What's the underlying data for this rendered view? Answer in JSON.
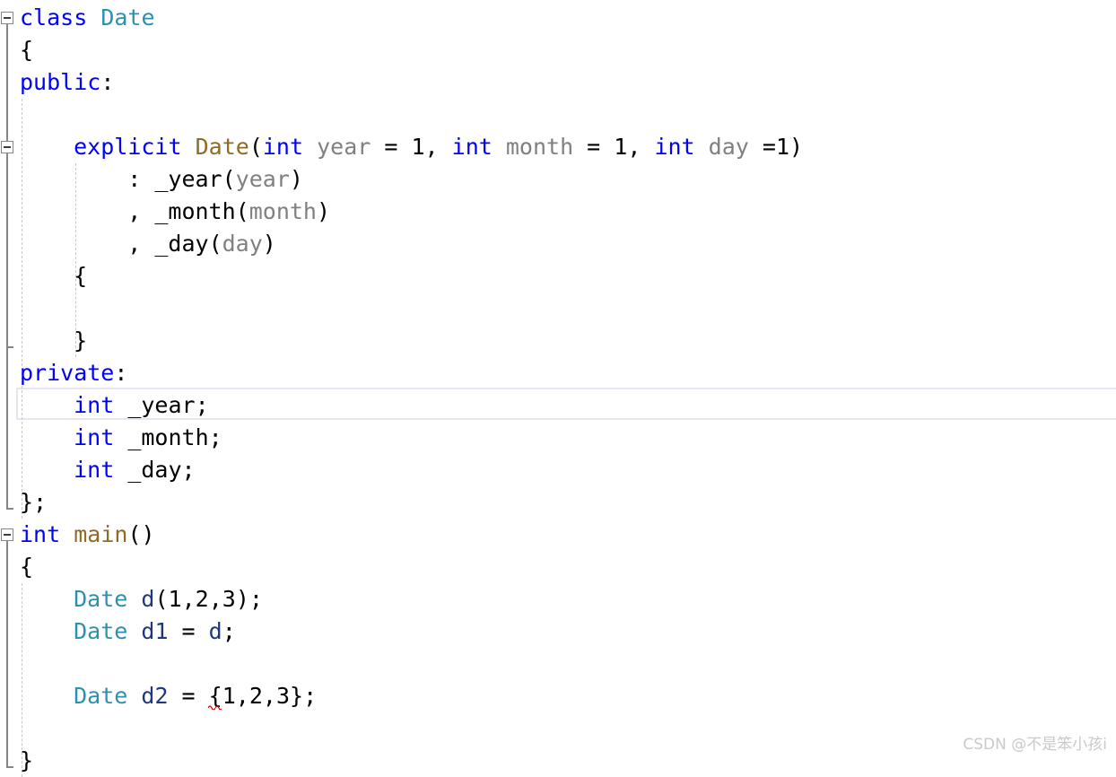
{
  "editor": {
    "language": "cpp",
    "background_color": "#ffffff",
    "current_line_number": 12,
    "colors": {
      "keyword": "#0000ff",
      "type": "#2b91af",
      "function": "#8f6a23",
      "parameter": "#808080",
      "local_variable": "#1f377f",
      "plain_text": "#000000",
      "indent_guide": "#c8c8c8",
      "fold_marker": "#868686",
      "current_line_border": "#e6e6f0",
      "error_squiggle": "#e00000",
      "watermark": "#c9c9c9"
    }
  },
  "gutter": {
    "fold_markers": [
      {
        "name": "fold-class-date",
        "state": "expanded",
        "line": 1
      },
      {
        "name": "fold-constructor",
        "state": "expanded",
        "line": 5
      },
      {
        "name": "fold-main",
        "state": "expanded",
        "line": 17
      }
    ]
  },
  "code_lines": [
    {
      "n": 1,
      "indent": 0,
      "tokens": [
        {
          "t": "class",
          "c": "kw"
        },
        {
          "t": " ",
          "c": "punct"
        },
        {
          "t": "Date",
          "c": "type"
        }
      ]
    },
    {
      "n": 2,
      "indent": 0,
      "tokens": [
        {
          "t": "{",
          "c": "punct"
        }
      ]
    },
    {
      "n": 3,
      "indent": 0,
      "tokens": [
        {
          "t": "public",
          "c": "kw"
        },
        {
          "t": ":",
          "c": "punct"
        }
      ]
    },
    {
      "n": 4,
      "indent": 0,
      "tokens": []
    },
    {
      "n": 5,
      "indent": 1,
      "tokens": [
        {
          "t": "explicit",
          "c": "kw"
        },
        {
          "t": " ",
          "c": "punct"
        },
        {
          "t": "Date",
          "c": "fn"
        },
        {
          "t": "(",
          "c": "punct"
        },
        {
          "t": "int",
          "c": "kw"
        },
        {
          "t": " ",
          "c": "punct"
        },
        {
          "t": "year",
          "c": "ident"
        },
        {
          "t": " = ",
          "c": "punct"
        },
        {
          "t": "1",
          "c": "num"
        },
        {
          "t": ", ",
          "c": "punct"
        },
        {
          "t": "int",
          "c": "kw"
        },
        {
          "t": " ",
          "c": "punct"
        },
        {
          "t": "month",
          "c": "ident"
        },
        {
          "t": " = ",
          "c": "punct"
        },
        {
          "t": "1",
          "c": "num"
        },
        {
          "t": ", ",
          "c": "punct"
        },
        {
          "t": "int",
          "c": "kw"
        },
        {
          "t": " ",
          "c": "punct"
        },
        {
          "t": "day",
          "c": "ident"
        },
        {
          "t": " =",
          "c": "punct"
        },
        {
          "t": "1",
          "c": "num"
        },
        {
          "t": ")",
          "c": "punct"
        }
      ]
    },
    {
      "n": 6,
      "indent": 2,
      "tokens": [
        {
          "t": ": ",
          "c": "punct"
        },
        {
          "t": "_year",
          "c": "punct"
        },
        {
          "t": "(",
          "c": "punct"
        },
        {
          "t": "year",
          "c": "ident"
        },
        {
          "t": ")",
          "c": "punct"
        }
      ]
    },
    {
      "n": 7,
      "indent": 2,
      "tokens": [
        {
          "t": ", ",
          "c": "punct"
        },
        {
          "t": "_month",
          "c": "punct"
        },
        {
          "t": "(",
          "c": "punct"
        },
        {
          "t": "month",
          "c": "ident"
        },
        {
          "t": ")",
          "c": "punct"
        }
      ]
    },
    {
      "n": 8,
      "indent": 2,
      "tokens": [
        {
          "t": ", ",
          "c": "punct"
        },
        {
          "t": "_day",
          "c": "punct"
        },
        {
          "t": "(",
          "c": "punct"
        },
        {
          "t": "day",
          "c": "ident"
        },
        {
          "t": ")",
          "c": "punct"
        }
      ]
    },
    {
      "n": 9,
      "indent": 1,
      "tokens": [
        {
          "t": "{",
          "c": "punct"
        }
      ]
    },
    {
      "n": 10,
      "indent": 0,
      "tokens": []
    },
    {
      "n": 11,
      "indent": 1,
      "tokens": [
        {
          "t": "}",
          "c": "punct"
        }
      ]
    },
    {
      "n": 12,
      "indent": 0,
      "tokens": [
        {
          "t": "private",
          "c": "kw"
        },
        {
          "t": ":",
          "c": "punct"
        }
      ]
    },
    {
      "n": 13,
      "indent": 1,
      "tokens": [
        {
          "t": "int",
          "c": "kw"
        },
        {
          "t": " ",
          "c": "punct"
        },
        {
          "t": "_year",
          "c": "punct"
        },
        {
          "t": ";",
          "c": "punct"
        }
      ]
    },
    {
      "n": 14,
      "indent": 1,
      "tokens": [
        {
          "t": "int",
          "c": "kw"
        },
        {
          "t": " ",
          "c": "punct"
        },
        {
          "t": "_month",
          "c": "punct"
        },
        {
          "t": ";",
          "c": "punct"
        }
      ]
    },
    {
      "n": 15,
      "indent": 1,
      "tokens": [
        {
          "t": "int",
          "c": "kw"
        },
        {
          "t": " ",
          "c": "punct"
        },
        {
          "t": "_day",
          "c": "punct"
        },
        {
          "t": ";",
          "c": "punct"
        }
      ]
    },
    {
      "n": 16,
      "indent": 0,
      "tokens": [
        {
          "t": "};",
          "c": "punct"
        }
      ]
    },
    {
      "n": 17,
      "indent": 0,
      "tokens": [
        {
          "t": "int",
          "c": "kw"
        },
        {
          "t": " ",
          "c": "punct"
        },
        {
          "t": "main",
          "c": "fn"
        },
        {
          "t": "()",
          "c": "punct"
        }
      ]
    },
    {
      "n": 18,
      "indent": 0,
      "tokens": [
        {
          "t": "{",
          "c": "punct"
        }
      ]
    },
    {
      "n": 19,
      "indent": 1,
      "tokens": [
        {
          "t": "Date",
          "c": "type"
        },
        {
          "t": " ",
          "c": "punct"
        },
        {
          "t": "d",
          "c": "var"
        },
        {
          "t": "(",
          "c": "punct"
        },
        {
          "t": "1",
          "c": "num"
        },
        {
          "t": ",",
          "c": "punct"
        },
        {
          "t": "2",
          "c": "num"
        },
        {
          "t": ",",
          "c": "punct"
        },
        {
          "t": "3",
          "c": "num"
        },
        {
          "t": ");",
          "c": "punct"
        }
      ]
    },
    {
      "n": 20,
      "indent": 1,
      "tokens": [
        {
          "t": "Date",
          "c": "type"
        },
        {
          "t": " ",
          "c": "punct"
        },
        {
          "t": "d1",
          "c": "var"
        },
        {
          "t": " = ",
          "c": "punct"
        },
        {
          "t": "d",
          "c": "var"
        },
        {
          "t": ";",
          "c": "punct"
        }
      ]
    },
    {
      "n": 21,
      "indent": 0,
      "tokens": []
    },
    {
      "n": 22,
      "indent": 1,
      "tokens": [
        {
          "t": "Date",
          "c": "type"
        },
        {
          "t": " ",
          "c": "punct"
        },
        {
          "t": "d2",
          "c": "var"
        },
        {
          "t": " = ",
          "c": "punct"
        },
        {
          "t": "{",
          "c": "punct"
        },
        {
          "t": "1",
          "c": "num"
        },
        {
          "t": ",",
          "c": "punct"
        },
        {
          "t": "2",
          "c": "num"
        },
        {
          "t": ",",
          "c": "punct"
        },
        {
          "t": "3",
          "c": "num"
        },
        {
          "t": "};",
          "c": "punct"
        }
      ]
    },
    {
      "n": 23,
      "indent": 0,
      "tokens": []
    },
    {
      "n": 24,
      "indent": 0,
      "tokens": [
        {
          "t": "}",
          "c": "punct"
        }
      ]
    }
  ],
  "diagnostics": [
    {
      "name": "error-squiggle-brace-init",
      "line": 22,
      "underline_text": "{"
    }
  ],
  "watermark": {
    "text": "CSDN @不是笨小孩i"
  }
}
